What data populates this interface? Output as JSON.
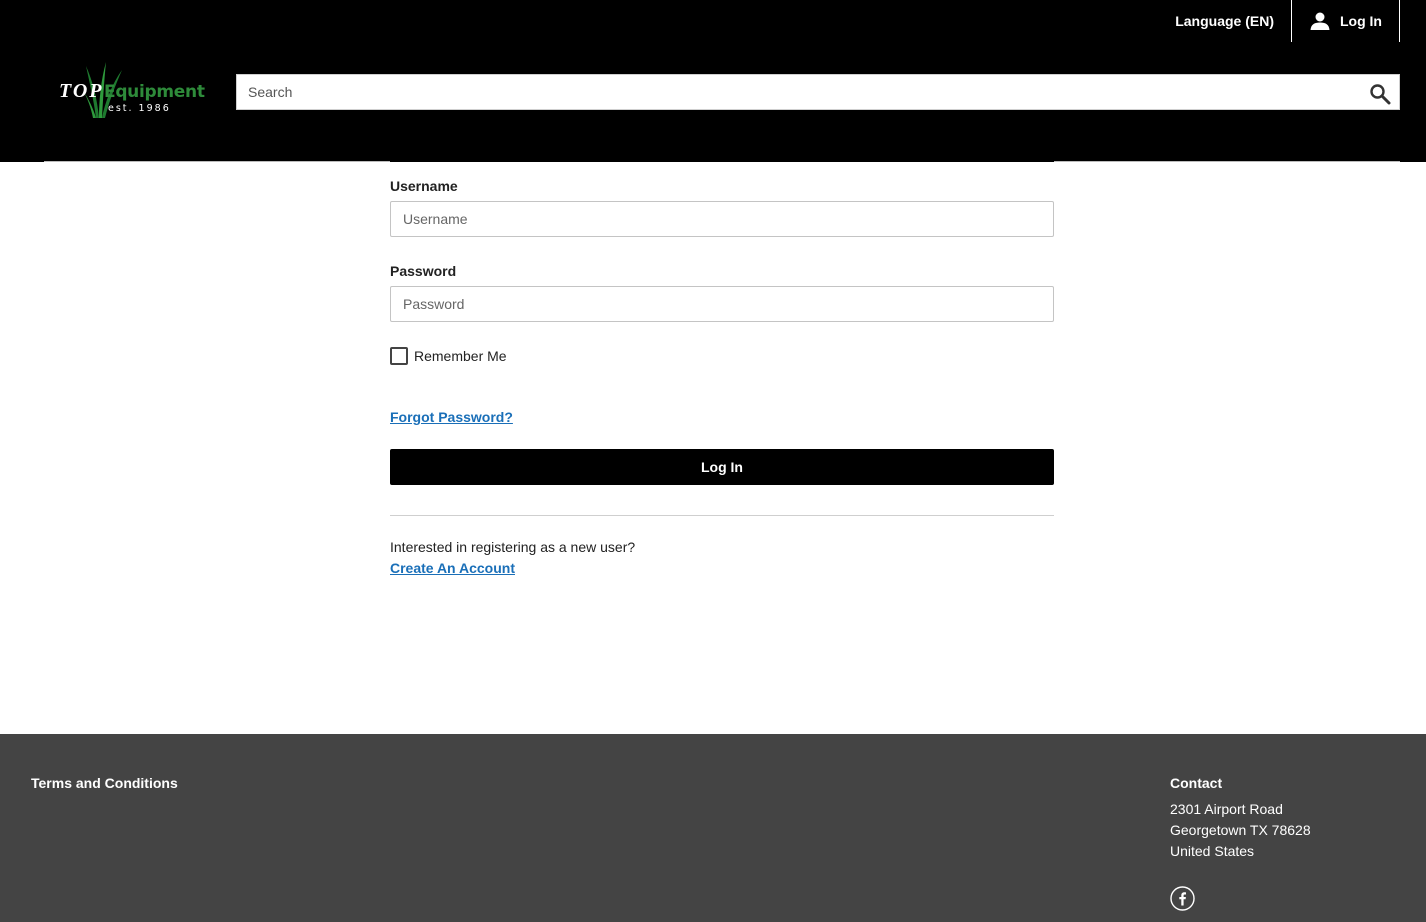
{
  "header": {
    "language_label": "Language (EN)",
    "login_label": "Log In",
    "logo": {
      "top": "TOP",
      "equipment": "Equipment",
      "est": "est. 1986"
    },
    "search": {
      "placeholder": "Search",
      "value": ""
    }
  },
  "form": {
    "username_label": "Username",
    "username_placeholder": "Username",
    "username_value": "",
    "password_label": "Password",
    "password_placeholder": "Password",
    "password_value": "",
    "remember_label": "Remember Me",
    "remember_checked": false,
    "forgot_link": "Forgot Password?",
    "login_button": "Log In",
    "register_prompt": "Interested in registering as a new user?",
    "create_link": "Create An Account"
  },
  "footer": {
    "terms": "Terms and Conditions",
    "contact_title": "Contact",
    "address_line1": "2301 Airport Road",
    "address_line2": "Georgetown TX 78628",
    "address_line3": "United States"
  },
  "colors": {
    "header_bg": "#000000",
    "footer_bg": "#444444",
    "link": "#1a6fb8",
    "logo_green": "#2e8b3a"
  },
  "icons": [
    "user-icon",
    "search-icon",
    "facebook-icon",
    "grass-logo-icon"
  ]
}
